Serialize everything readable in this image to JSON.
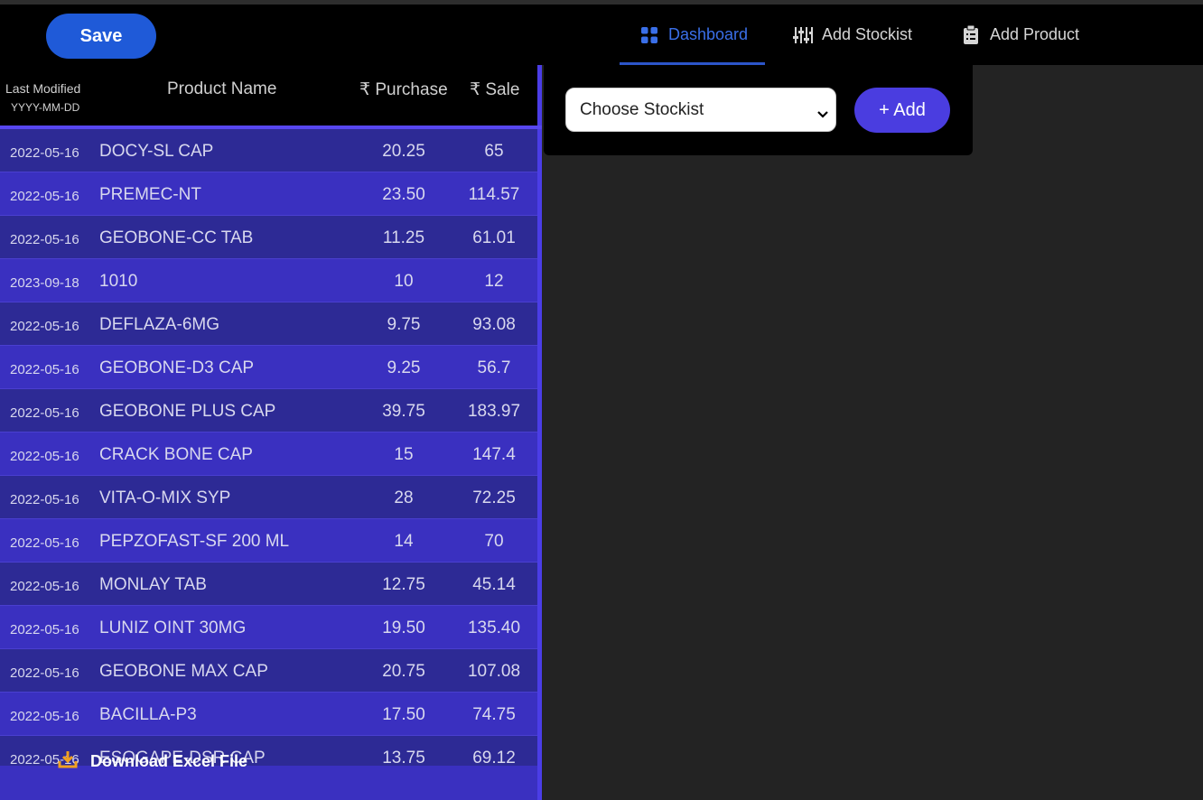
{
  "toolbar": {
    "save_label": "Save"
  },
  "nav": {
    "dashboard": "Dashboard",
    "add_stockist": "Add Stockist",
    "add_product": "Add Product"
  },
  "colors": {
    "accent": "#4b3de6",
    "active_nav": "#3a6fe8",
    "save": "#1f5ad8",
    "download_icon": "#f0a020"
  },
  "table": {
    "headers": {
      "last_modified": "Last Modified",
      "date_format": "YYYY-MM-DD",
      "product_name": "Product Name",
      "purchase": "₹ Purchase",
      "sale": "₹ Sale"
    },
    "rows": [
      {
        "date": "2022-05-16",
        "name": "DOCY-SL CAP",
        "purchase": "20.25",
        "sale": "65"
      },
      {
        "date": "2022-05-16",
        "name": "PREMEC-NT",
        "purchase": "23.50",
        "sale": "114.57"
      },
      {
        "date": "2022-05-16",
        "name": "GEOBONE-CC TAB",
        "purchase": "11.25",
        "sale": "61.01"
      },
      {
        "date": "2023-09-18",
        "name": "1010",
        "purchase": "10",
        "sale": "12"
      },
      {
        "date": "2022-05-16",
        "name": "DEFLAZA-6MG",
        "purchase": "9.75",
        "sale": "93.08"
      },
      {
        "date": "2022-05-16",
        "name": "GEOBONE-D3 CAP",
        "purchase": "9.25",
        "sale": "56.7"
      },
      {
        "date": "2022-05-16",
        "name": "GEOBONE PLUS CAP",
        "purchase": "39.75",
        "sale": "183.97"
      },
      {
        "date": "2022-05-16",
        "name": "CRACK BONE CAP",
        "purchase": "15",
        "sale": "147.4"
      },
      {
        "date": "2022-05-16",
        "name": "VITA-O-MIX SYP",
        "purchase": "28",
        "sale": "72.25"
      },
      {
        "date": "2022-05-16",
        "name": "PEPZOFAST-SF 200 ML",
        "purchase": "14",
        "sale": "70"
      },
      {
        "date": "2022-05-16",
        "name": "MONLAY TAB",
        "purchase": "12.75",
        "sale": "45.14"
      },
      {
        "date": "2022-05-16",
        "name": "LUNIZ OINT 30MG",
        "purchase": "19.50",
        "sale": "135.40"
      },
      {
        "date": "2022-05-16",
        "name": "GEOBONE MAX CAP",
        "purchase": "20.75",
        "sale": "107.08"
      },
      {
        "date": "2022-05-16",
        "name": "BACILLA-P3",
        "purchase": "17.50",
        "sale": "74.75"
      },
      {
        "date": "2022-05-16",
        "name": "ESOGAPE-DSR CAP",
        "purchase": "13.75",
        "sale": "69.12"
      }
    ]
  },
  "download": {
    "label": "Download Excel File",
    "icon": "download-icon"
  },
  "stockist": {
    "select_value": "Choose Stockist",
    "add_label": "+ Add"
  }
}
